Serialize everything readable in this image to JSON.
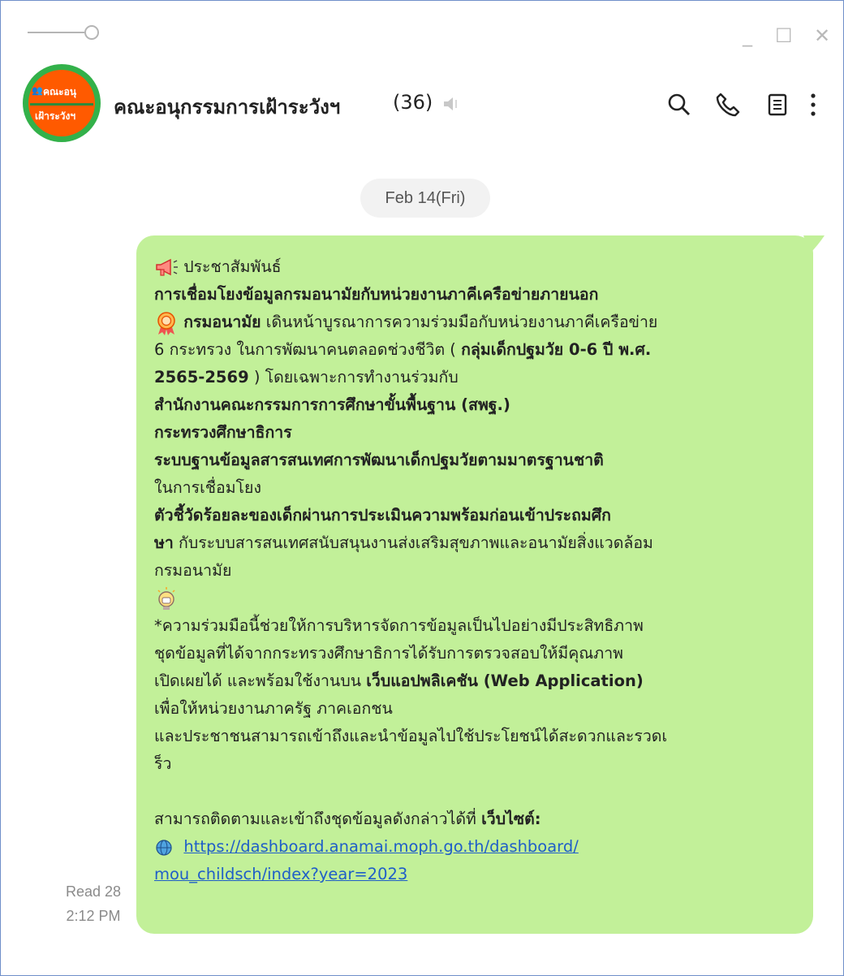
{
  "window": {
    "minimize_glyph": "_",
    "maximize_glyph": "☐",
    "close_glyph": "✕"
  },
  "chat": {
    "avatar_top": "คณะอนุ",
    "avatar_bottom": "เฝ้าระวังฯ",
    "title": "คณะอนุกรรมการเฝ้าระวังฯ",
    "member_count": "(36)"
  },
  "date_separator": "Feb 14(Fri)",
  "message": {
    "line1": "ประชาสัมพันธ์",
    "line2": "การเชื่อมโยงข้อมูลกรมอนามัยกับหน่วยงานภาคีเครือข่ายภายนอก",
    "line3_bold": "กรมอนามัย",
    "line3_rest": " เดินหน้าบูรณาการความร่วมมือกับหน่วยงานภาคีเครือข่าย",
    "line4_a": "6 กระทรวง ในการพัฒนาคนตลอดช่วงชีวิต ( ",
    "line4_bold": "กลุ่มเด็กปฐมวัย 0-6 ปี พ.ศ.",
    "line5_bold": "2565-2569",
    "line5_rest": " ) โดยเฉพาะการทำงานร่วมกับ",
    "line6": "สำนักงานคณะกรรมการการศึกษาขั้นพื้นฐาน (สพฐ.)",
    "line7": "กระทรวงศึกษาธิการ",
    "line8": "ระบบฐานข้อมูลสารสนเทศการพัฒนาเด็กปฐมวัยตามมาตรฐานชาติ",
    "line9": "ในการเชื่อมโยง",
    "line10": "ตัวชี้วัดร้อยละของเด็กผ่านการประเมินความพร้อมก่อนเข้าประถมศึก",
    "line11_bold": "ษา",
    "line11_rest": " กับระบบสารสนเทศสนับสนุนงานส่งเสริมสุขภาพและอนามัยสิ่งแวดล้อม",
    "line12": "กรมอนามัย",
    "line13": "*ความร่วมมือนี้ช่วยให้การบริหารจัดการข้อมูลเป็นไปอย่างมีประสิทธิภาพ",
    "line14": "ชุดข้อมูลที่ได้จากกระทรวงศึกษาธิการได้รับการตรวจสอบให้มีคุณภาพ",
    "line15_a": "เปิดเผยได้ และพร้อมใช้งานบน ",
    "line15_bold": "เว็บแอปพลิเคชัน (Web Application)",
    "line16": "เพื่อให้หน่วยงานภาครัฐ ภาคเอกชน",
    "line17": "และประชาชนสามารถเข้าถึงและนำข้อมูลไปใช้ประโยชน์ได้สะดวกและรวดเ",
    "line18": "ร็ว",
    "line19_a": "สามารถติดตามและเข้าถึงชุดข้อมูลดังกล่าวได้ที่ ",
    "line19_bold": "เว็บไซต์:",
    "link_line1": "https://dashboard.anamai.moph.go.th/dashboard/",
    "link_line2": "mou_childsch/index?year=2023"
  },
  "status": {
    "read": "Read 28",
    "time": "2:12 PM"
  },
  "icons": [
    "pin-icon",
    "speaker-muted-icon",
    "search-icon",
    "phone-icon",
    "notes-icon",
    "more-icon",
    "megaphone-icon",
    "rosette-icon",
    "lightbulb-icon",
    "globe-icon"
  ]
}
